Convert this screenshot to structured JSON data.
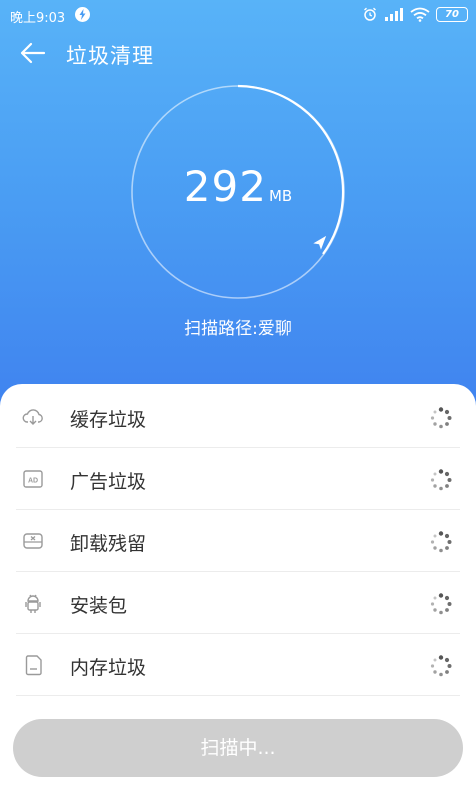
{
  "status_bar": {
    "time": "晚上9:03",
    "battery": "70"
  },
  "header": {
    "title": "垃圾清理"
  },
  "scan": {
    "size_value": "292",
    "size_unit": "MB",
    "path_text": "扫描路径:爱聊"
  },
  "items": [
    {
      "label": "缓存垃圾",
      "icon": "cloud-download-icon"
    },
    {
      "label": "广告垃圾",
      "icon": "ad-icon"
    },
    {
      "label": "卸载残留",
      "icon": "uninstall-icon"
    },
    {
      "label": "安装包",
      "icon": "android-icon"
    },
    {
      "label": "内存垃圾",
      "icon": "sd-card-icon"
    }
  ],
  "action": {
    "button_label": "扫描中..."
  },
  "colors": {
    "header_top": "#58b3f8",
    "header_bottom": "#3e7fef",
    "button_disabled": "#cfcfcf"
  }
}
